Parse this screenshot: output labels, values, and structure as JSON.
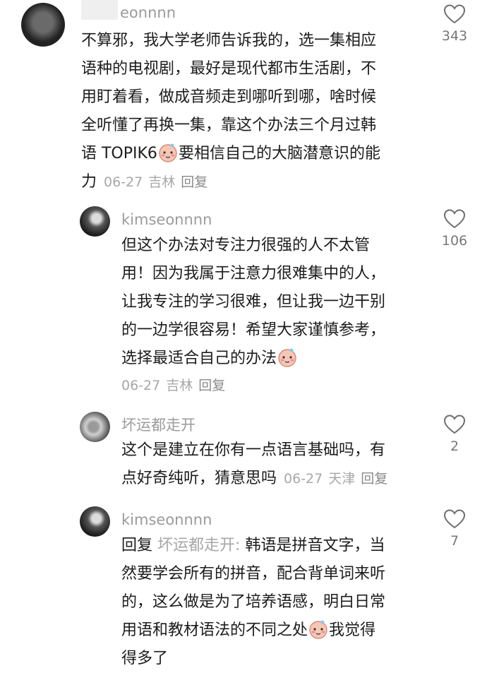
{
  "comments": [
    {
      "username": "eonnnn",
      "lines": [
        "不算邪，我大学老师告诉我的，选一集相应",
        "语种的电视剧，最好是现代都市生活剧，不",
        "用盯着看，做成音频走到哪听到哪，啥时候",
        "全听懂了再换一集，靠这个办法三个月过韩"
      ],
      "line5_pre": "语 TOPIK6",
      "line5_post": "要相信自己的大脑潜意识的能",
      "line6": "力",
      "date": "06-27",
      "location": "吉林",
      "reply": "回复",
      "likes": "343"
    },
    {
      "username": "kimseonnnn",
      "lines": [
        "但这个办法对专注力很强的人不太管",
        "用！因为我属于注意力很难集中的人，",
        "让我专注的学习很难，但让我一边干别",
        "的一边学很容易！希望大家谨慎参考，"
      ],
      "line5_pre": "选择最适合自己的办法",
      "date": "06-27",
      "location": "吉林",
      "reply": "回复",
      "likes": "106"
    },
    {
      "username": "坏运都走开",
      "lines": [
        "这个是建立在你有一点语言基础吗，有"
      ],
      "line2_pre": "点好奇纯听，猜意思吗",
      "date": "06-27",
      "location": "天津",
      "reply": "回复",
      "likes": "2"
    },
    {
      "username": "kimseonnnn",
      "reply_prefix": "回复",
      "reply_target": "坏运都走开:",
      "line1_rest": "韩语是拼音文字，当",
      "lines": [
        "然要学会所有的拼音，配合背单词来听",
        "的，这么做是为了培养语感，明白日常"
      ],
      "line4_pre": "用语和教材语法的不同之处",
      "line4_post": "我觉得",
      "line5": "得多了",
      "likes": "7"
    }
  ],
  "colors": {
    "text": "#1c1c1c",
    "username": "#9b9b9b",
    "meta": "#a7a7a7",
    "heart": "#6e6e6e"
  }
}
